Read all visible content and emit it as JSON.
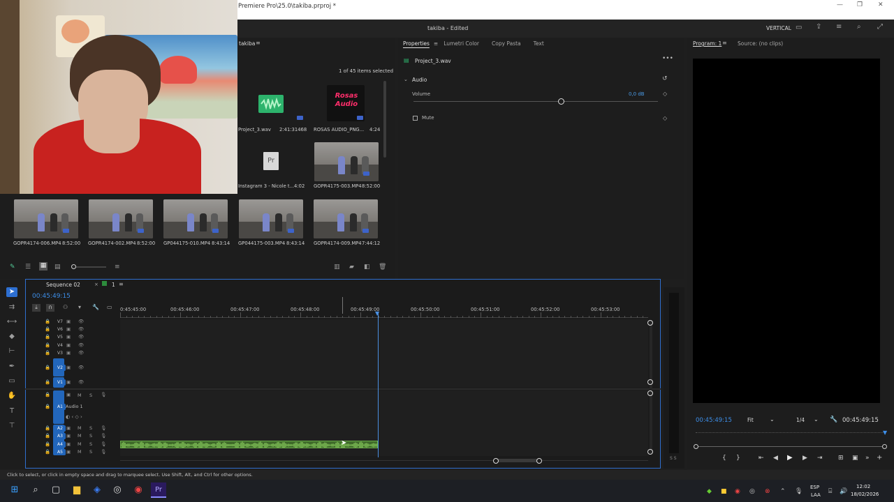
{
  "window": {
    "title": "Premiere Pro\\25.0\\takiba.prproj *",
    "buttons": [
      "—",
      "❐",
      "✕"
    ]
  },
  "appbar": {
    "project_status": "takiba - Edited",
    "workspace": "VERTICAL"
  },
  "project_panel": {
    "tab": "takiba",
    "selection_status": "1 of 45 items selected",
    "items": [
      {
        "name": "Project_3.wav",
        "duration": "2:41:31468"
      },
      {
        "name": "ROSAS AUDIO_PNG...",
        "duration": "4:24"
      },
      {
        "name": "Instagram 3 - Nicole t...",
        "duration": "4:02"
      },
      {
        "name": "GOPR4175-003.MP4",
        "duration": "8:52:00"
      },
      {
        "name": "GOPR4174-006.MP4",
        "duration": "8:52:00"
      },
      {
        "name": "GOPR4174-002.MP4",
        "duration": "8:52:00"
      },
      {
        "name": "GP044175-010.MP4",
        "duration": "8:43:14"
      },
      {
        "name": "GP044175-003.MP4",
        "duration": "8:43:14"
      },
      {
        "name": "GOPR4174-009.MP4",
        "duration": "7:44:12"
      }
    ],
    "logo_text": "Rosas Audio",
    "file_type_label": "Pr"
  },
  "properties_panel": {
    "tabs": [
      "Properties",
      "Lumetri Color",
      "Copy Pasta",
      "Text"
    ],
    "clip_name": "Project_3.wav",
    "section": "Audio",
    "volume_label": "Volume",
    "volume_value": "0,0 dB",
    "mute_label": "Mute"
  },
  "program_monitor": {
    "tabs": [
      "Program: 1",
      "Source: (no clips)"
    ],
    "timecode_current": "00:45:49:15",
    "fit": "Fit",
    "resolution": "1/4",
    "timecode_duration": "00:45:49:15"
  },
  "timeline": {
    "sequence_tab": "Sequence 02",
    "sequence_alt_tab": "1",
    "playhead_timecode": "00:45:49:15",
    "ruler": [
      "0:45:45:00",
      "00:45:46:00",
      "00:45:47:00",
      "00:45:48:00",
      "00:45:49:00",
      "00:45:50:00",
      "00:45:51:00",
      "00:45:52:00",
      "00:45:53:00"
    ],
    "video_tracks": [
      "V7",
      "V6",
      "V5",
      "V4",
      "V3",
      "V2",
      "V1"
    ],
    "audio_tracks": [
      "A1",
      "A2",
      "A3",
      "A4",
      "A5"
    ],
    "audio1_name": "Audio 1",
    "track_m": "M",
    "track_s": "S",
    "meter_labels": "S S"
  },
  "status_bar": {
    "hint": "Click to select, or click in empty space and drag to marquee select. Use Shift, Alt, and Ctrl for other options."
  },
  "taskbar": {
    "lang": "ESP",
    "lang2": "LAA",
    "time": "12:02",
    "date": "18/02/2026"
  },
  "colors": {
    "accent_blue": "#2d8ceb",
    "playhead": "#4a90e2",
    "audio_clip": "#7cc35a"
  }
}
